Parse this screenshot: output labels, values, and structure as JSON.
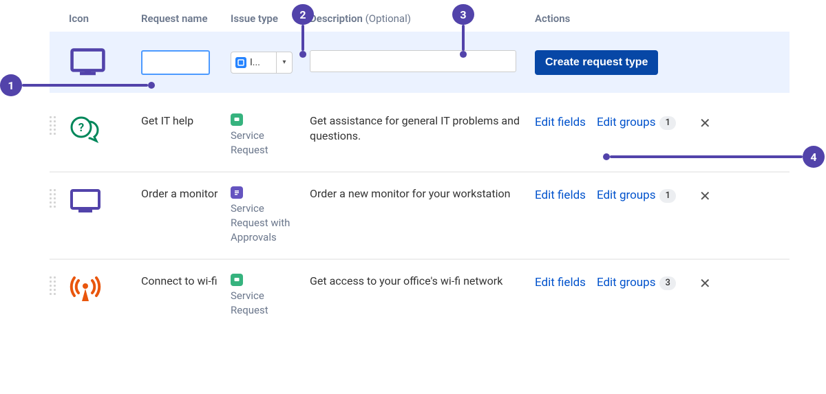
{
  "headers": {
    "icon": "Icon",
    "request_name": "Request name",
    "issue_type": "Issue type",
    "description": "Description",
    "description_note": "(Optional)",
    "actions": "Actions"
  },
  "create": {
    "name_value": "",
    "issue_label": "I...",
    "desc_value": "",
    "button": "Create request type"
  },
  "rows": [
    {
      "name": "Get IT help",
      "issue_type": "Service Request",
      "issue_badge_color": "green",
      "description": "Get assistance for general IT problems and questions.",
      "icon": "help-chat-icon",
      "icon_color": "#00875A",
      "group_count": 1
    },
    {
      "name": "Order a monitor",
      "issue_type": "Service Request with Approvals",
      "issue_badge_color": "purple",
      "description": "Order a new monitor for your workstation",
      "icon": "monitor-icon",
      "icon_color": "#5243AA",
      "group_count": 1
    },
    {
      "name": "Connect to wi-fi",
      "issue_type": "Service Request",
      "issue_badge_color": "green",
      "description": "Get access to your office's wi-fi network",
      "icon": "wifi-antenna-icon",
      "icon_color": "#E9560D",
      "group_count": 3
    }
  ],
  "actions_labels": {
    "edit_fields": "Edit fields",
    "edit_groups": "Edit groups"
  },
  "annotations": {
    "a1": "1",
    "a2": "2",
    "a3": "3",
    "a4": "4"
  }
}
